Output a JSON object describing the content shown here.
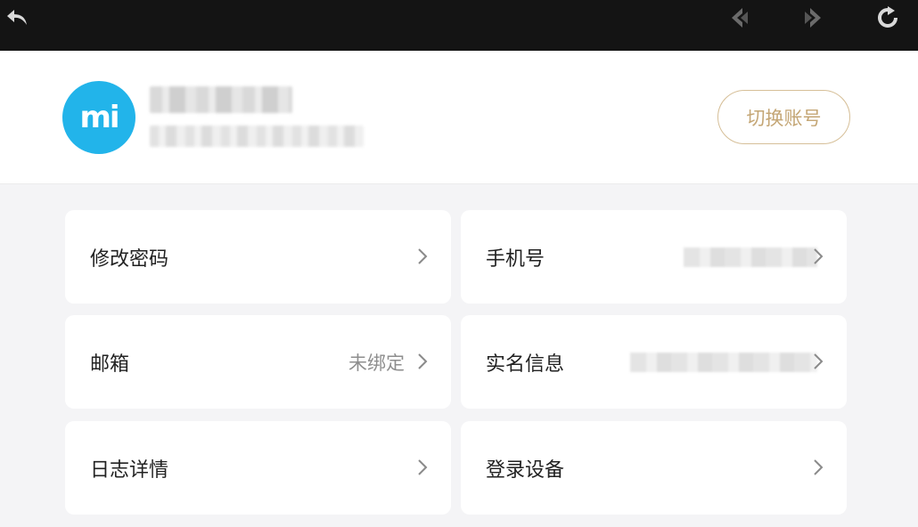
{
  "header": {
    "avatar_text": "mi",
    "user_name": "",
    "user_id": "",
    "switch_account": "切换账号"
  },
  "settings": {
    "items": [
      {
        "label": "修改密码",
        "value": ""
      },
      {
        "label": "手机号",
        "value": ""
      },
      {
        "label": "邮箱",
        "value": "未绑定"
      },
      {
        "label": "实名信息",
        "value": ""
      },
      {
        "label": "日志详情",
        "value": ""
      },
      {
        "label": "登录设备",
        "value": ""
      }
    ]
  },
  "colors": {
    "topbar": "#141414",
    "avatar": "#22b4ea",
    "accent_gold": "#c4a675",
    "background": "#f4f4f6"
  },
  "icons": {
    "back": "back-arrow-icon",
    "prev": "nav-prev-icon",
    "next": "nav-next-icon",
    "refresh": "refresh-icon",
    "chevron": "chevron-right-icon"
  }
}
